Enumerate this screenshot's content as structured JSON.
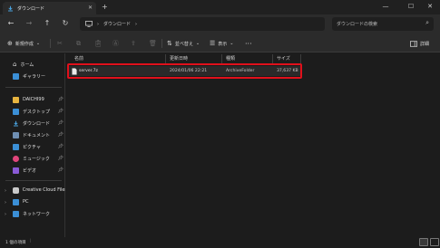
{
  "window": {
    "tab_title": "ダウンロード",
    "tab_close": "✕",
    "new_tab": "+",
    "minimize": "—",
    "maximize": "☐",
    "close": "✕"
  },
  "nav": {
    "back": "←",
    "forward": "→",
    "up": "↑",
    "refresh": "↻",
    "breadcrumb": [
      "ダウンロード"
    ],
    "search_placeholder": "ダウンロードの検索"
  },
  "toolbar": {
    "new_label": "新規作成",
    "sort_label": "並べ替え",
    "view_label": "表示",
    "more_label": "···",
    "details_label": "詳細"
  },
  "sidebar": {
    "quick": [
      {
        "label": "ホーム",
        "icon": "home-icon"
      },
      {
        "label": "ギャラリー",
        "icon": "gallery-icon"
      }
    ],
    "pinned": [
      {
        "label": "DAICHI99",
        "icon": "folder-icon"
      },
      {
        "label": "デスクトップ",
        "icon": "desktop-icon"
      },
      {
        "label": "ダウンロード",
        "icon": "download-icon"
      },
      {
        "label": "ドキュメント",
        "icon": "document-icon"
      },
      {
        "label": "ピクチャ",
        "icon": "picture-icon"
      },
      {
        "label": "ミュージック",
        "icon": "music-icon"
      },
      {
        "label": "ビデオ",
        "icon": "video-icon"
      }
    ],
    "locations": [
      {
        "label": "Creative Cloud Files",
        "icon": "creative-cloud-icon"
      },
      {
        "label": "PC",
        "icon": "pc-icon"
      },
      {
        "label": "ネットワーク",
        "icon": "network-icon"
      }
    ]
  },
  "columns": {
    "name": "名前",
    "date": "更新日時",
    "type": "種類",
    "size": "サイズ"
  },
  "files": [
    {
      "name": "server.7z",
      "date": "2024/01/06 22:21",
      "type": "ArchiveFolder",
      "size": "37,637 KB"
    }
  ],
  "status": {
    "count": "1 個の項目"
  },
  "colors": {
    "highlight": "#e0101b",
    "accent": "#4aa3df"
  }
}
